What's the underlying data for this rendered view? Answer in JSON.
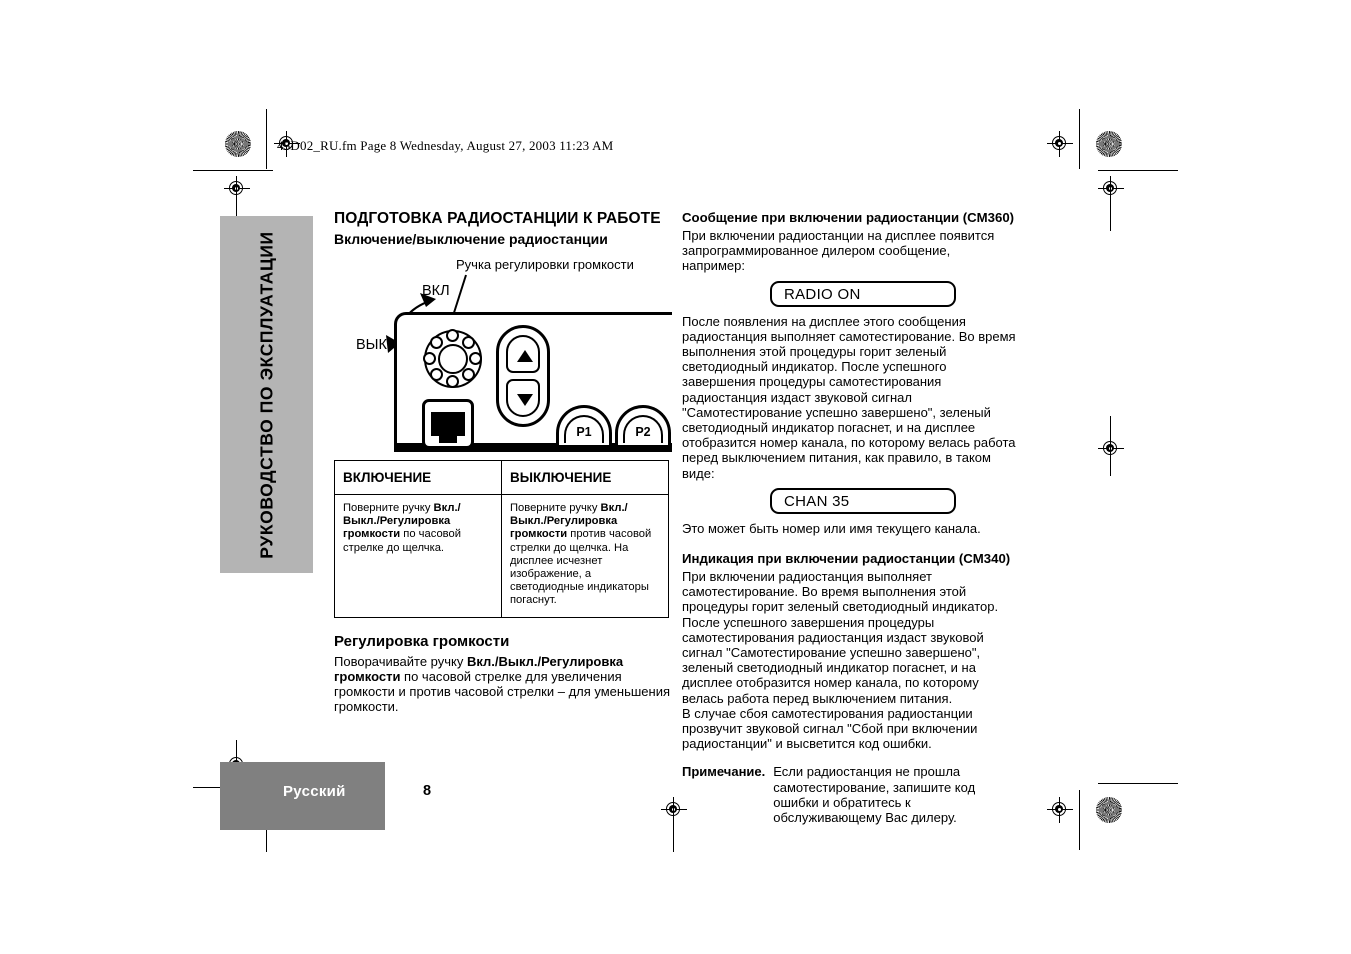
{
  "header": {
    "file_line": "45D02_RU.fm  Page 8  Wednesday, August 27, 2003  11:23 AM"
  },
  "side_tab": {
    "label": "РУКОВОДСТВО ПО ЭКСПЛУАТАЦИИ"
  },
  "left_column": {
    "section_title": "ПОДГОТОВКА РАДИОСТАНЦИИ К РАБОТЕ",
    "subsection_title": "Включение/выключение радиостанции",
    "figure": {
      "knob_label": "Ручка регулировки громкости",
      "on_label": "ВКЛ",
      "off_label": "ВЫК",
      "up_arrow_icon": "triangle-up-icon",
      "down_arrow_icon": "triangle-down-icon",
      "p1_button": "P1",
      "p2_button": "P2",
      "mic_jack_icon": "microphone-jack-icon",
      "volume_knob_icon": "rotary-knob-icon"
    },
    "table": {
      "headers": [
        "ВКЛЮЧЕНИЕ",
        "ВЫКЛЮЧЕНИЕ"
      ],
      "row": {
        "on_pre": "Поверните ручку ",
        "on_bold": "Вкл./Выкл./Регулировка громкости",
        "on_post": " по часовой стрелке до щелчка.",
        "off_pre": "Поверните ручку ",
        "off_bold": "Вкл./Выкл./Регулировка громкости",
        "off_post": " против часовой стрелки до щелчка. На дисплее исчезнет изображение, а светодиодные индикаторы погаснут."
      }
    },
    "volume_heading": "Регулировка громкости",
    "volume_pre": "Поворачивайте ручку ",
    "volume_bold": "Вкл./Выкл./Регулировка громкости",
    "volume_post": " по часовой стрелке для увеличения громкости и против часовой стрелки – для уменьшения громкости."
  },
  "right_column": {
    "cm360_heading": "Сообщение при включении радиостанции (CM360)",
    "cm360_intro": "При включении радиостанции на дисплее появится запрограммированное дилером сообщение, например:",
    "lcd_radio_on": "RADIO ON",
    "cm360_body": "После появления на дисплее этого сообщения радиостанция выполняет самотестирование. Во время выполнения этой процедуры горит зеленый светодиодный индикатор. После успешного завершения процедуры самотестирования радиостанция издаст звуковой сигнал \"Самотестирование успешно завершено\", зеленый светодиодный индикатор погаснет, и на дисплее отобразится номер канала, по которому велась работа перед выключением питания, как правило, в таком виде:",
    "lcd_chan": "CHAN  35",
    "cm360_after": "Это может быть номер или имя текущего канала.",
    "cm340_heading": "Индикация при включении радиостанции (CM340)",
    "cm340_body": "При включении радиостанция выполняет самотестирование. Во время выполнения этой процедуры горит зеленый светодиодный индикатор. После успешного завершения процедуры самотестирования радиостанция издаст звуковой сигнал \"Самотестирование успешно завершено\", зеленый светодиодный индикатор погаснет, и на дисплее отобразится номер канала, по которому велась работа перед выключением питания.",
    "cm340_body2": "В случае сбоя самотестирования радиостанции прозвучит звуковой сигнал \"Сбой при включении радиостанции\" и высветится код ошибки.",
    "note_label": "Примечание.",
    "note_body": "Если радиостанция не прошла самотестирование, запишите код ошибки и обратитесь к обслуживающему Вас дилеру."
  },
  "footer": {
    "language": "Русский",
    "page_number": "8"
  },
  "colors": {
    "side_tab_gray": "#b4b4b4",
    "footer_gray": "#808080",
    "ink": "#000000",
    "paper": "#ffffff"
  }
}
